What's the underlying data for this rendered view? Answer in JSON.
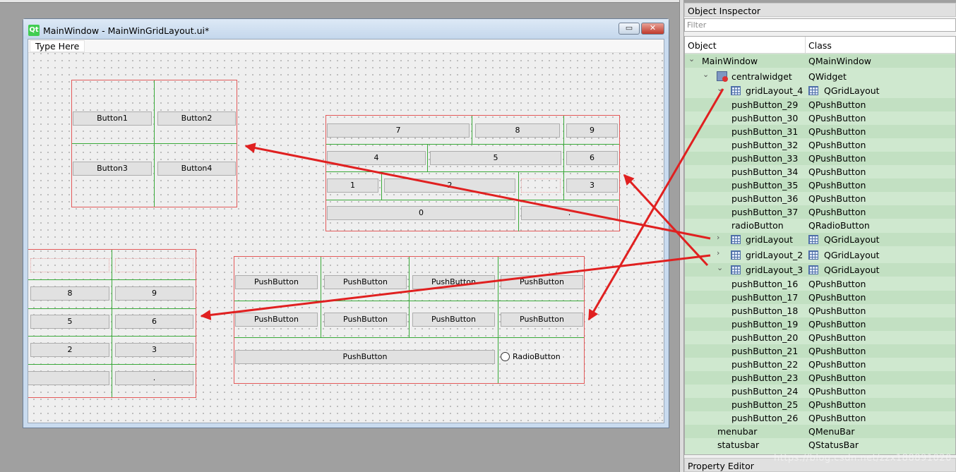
{
  "window": {
    "icon": "Qt",
    "title": "MainWindow - MainWinGridLayout.ui*",
    "minimize_label": "▭",
    "close_label": "✕"
  },
  "menubar": {
    "placeholder": "Type Here"
  },
  "layout4": {
    "buttons": [
      "Button1",
      "Button2",
      "Button3",
      "Button4"
    ]
  },
  "layout3": {
    "buttons": [
      "7",
      "8",
      "9",
      "4",
      "5",
      "6",
      "1",
      "2",
      "3",
      "0",
      "."
    ]
  },
  "layout2": {
    "buttons": [
      "8",
      "9",
      "5",
      "6",
      "2",
      "3",
      "."
    ]
  },
  "layout1": {
    "push_label": "PushButton",
    "radio_label": "RadioButton"
  },
  "object_inspector": {
    "title": "Object Inspector",
    "filter_placeholder": "Filter",
    "col_object": "Object",
    "col_class": "Class",
    "rows": [
      {
        "object": "MainWindow",
        "class": "QMainWindow"
      },
      {
        "object": "centralwidget",
        "class": "QWidget"
      },
      {
        "object": "gridLayout_4",
        "class": "QGridLayout"
      },
      {
        "object": "pushButton_29",
        "class": "QPushButton"
      },
      {
        "object": "pushButton_30",
        "class": "QPushButton"
      },
      {
        "object": "pushButton_31",
        "class": "QPushButton"
      },
      {
        "object": "pushButton_32",
        "class": "QPushButton"
      },
      {
        "object": "pushButton_33",
        "class": "QPushButton"
      },
      {
        "object": "pushButton_34",
        "class": "QPushButton"
      },
      {
        "object": "pushButton_35",
        "class": "QPushButton"
      },
      {
        "object": "pushButton_36",
        "class": "QPushButton"
      },
      {
        "object": "pushButton_37",
        "class": "QPushButton"
      },
      {
        "object": "radioButton",
        "class": "QRadioButton"
      },
      {
        "object": "gridLayout",
        "class": "QGridLayout"
      },
      {
        "object": "gridLayout_2",
        "class": "QGridLayout"
      },
      {
        "object": "gridLayout_3",
        "class": "QGridLayout"
      },
      {
        "object": "pushButton_16",
        "class": "QPushButton"
      },
      {
        "object": "pushButton_17",
        "class": "QPushButton"
      },
      {
        "object": "pushButton_18",
        "class": "QPushButton"
      },
      {
        "object": "pushButton_19",
        "class": "QPushButton"
      },
      {
        "object": "pushButton_20",
        "class": "QPushButton"
      },
      {
        "object": "pushButton_21",
        "class": "QPushButton"
      },
      {
        "object": "pushButton_22",
        "class": "QPushButton"
      },
      {
        "object": "pushButton_23",
        "class": "QPushButton"
      },
      {
        "object": "pushButton_24",
        "class": "QPushButton"
      },
      {
        "object": "pushButton_25",
        "class": "QPushButton"
      },
      {
        "object": "pushButton_26",
        "class": "QPushButton"
      },
      {
        "object": "menubar",
        "class": "QMenuBar"
      },
      {
        "object": "statusbar",
        "class": "QStatusBar"
      }
    ]
  },
  "property_editor": {
    "title": "Property Editor"
  },
  "watermark": "https://blog.csdn.net/zzx188891020",
  "colors": {
    "annotation_arrow": "#e02020",
    "layout_border": "#e35a5a",
    "grid_line": "#3aaa3a",
    "tree_bg": "#cfe8cf"
  }
}
